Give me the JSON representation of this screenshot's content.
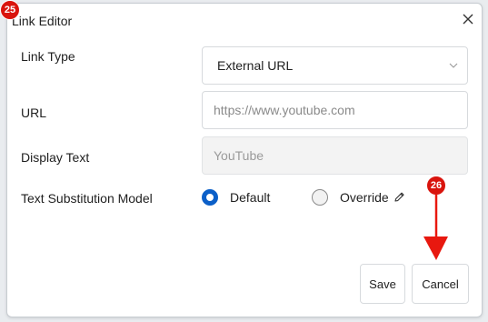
{
  "dialog": {
    "title": "Link Editor",
    "close_icon": "close-icon"
  },
  "form": {
    "link_type": {
      "label": "Link Type",
      "value": "External URL"
    },
    "url": {
      "label": "URL",
      "placeholder": "https://www.youtube.com"
    },
    "display_text": {
      "label": "Display Text",
      "placeholder": "YouTube"
    },
    "substitution": {
      "label": "Text Substitution Model",
      "options": [
        {
          "label": "Default",
          "selected": true
        },
        {
          "label": "Override",
          "selected": false
        }
      ]
    }
  },
  "footer": {
    "save_label": "Save",
    "cancel_label": "Cancel"
  },
  "annotations": {
    "badge_1": "25",
    "badge_2": "26",
    "color": "#d9140d"
  },
  "colors": {
    "accent": "#0b5fc8",
    "annotation": "#e8180f"
  }
}
